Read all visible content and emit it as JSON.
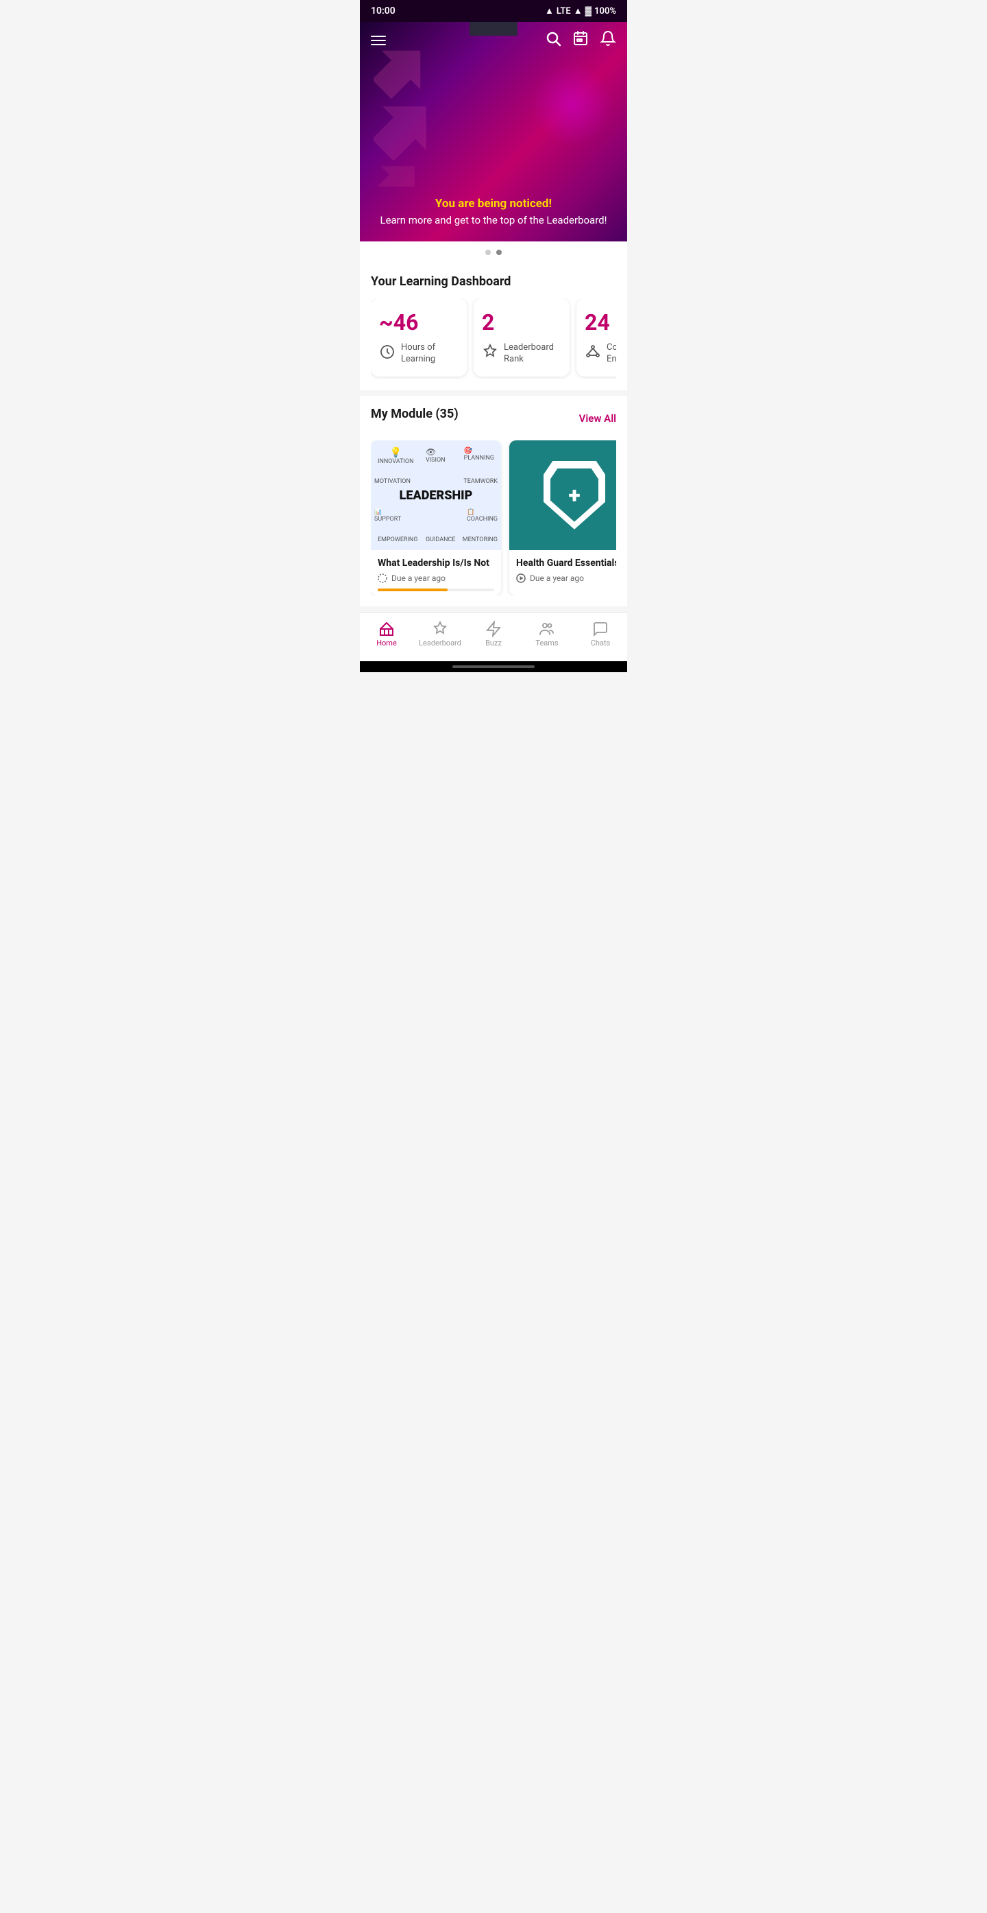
{
  "statusBar": {
    "time": "10:00",
    "signal": "LTE",
    "battery": "100%"
  },
  "hero": {
    "title": "You are being noticed!",
    "subtitle": "Learn more and get to the top of the Leaderboard!",
    "dots": [
      false,
      true
    ]
  },
  "dashboard": {
    "title": "Your Learning Dashboard",
    "cards": [
      {
        "number": "~46",
        "label": "Hours of Learning",
        "iconType": "clock"
      },
      {
        "number": "2",
        "label": "Leaderboard Rank",
        "iconType": "medal"
      },
      {
        "number": "24",
        "label": "Courses Enrolled",
        "iconType": "network"
      }
    ]
  },
  "modules": {
    "title": "My Module (35)",
    "viewAllLabel": "View All",
    "items": [
      {
        "id": 1,
        "title": "What Leadership Is/Is Not",
        "dueText": "Due a year ago",
        "type": "leadership",
        "dueIcon": "circle-dashed"
      },
      {
        "id": 2,
        "title": "Health Guard Essentials",
        "dueText": "Due a year ago",
        "type": "health",
        "dueIcon": "play-circle"
      }
    ]
  },
  "bottomNav": {
    "items": [
      {
        "id": "home",
        "label": "Home",
        "active": true,
        "iconType": "home"
      },
      {
        "id": "leaderboard",
        "label": "Leaderboard",
        "active": false,
        "iconType": "medal"
      },
      {
        "id": "buzz",
        "label": "Buzz",
        "active": false,
        "iconType": "buzz"
      },
      {
        "id": "teams",
        "label": "Teams",
        "active": false,
        "iconType": "teams"
      },
      {
        "id": "chats",
        "label": "Chats",
        "active": false,
        "iconType": "chats"
      }
    ]
  }
}
